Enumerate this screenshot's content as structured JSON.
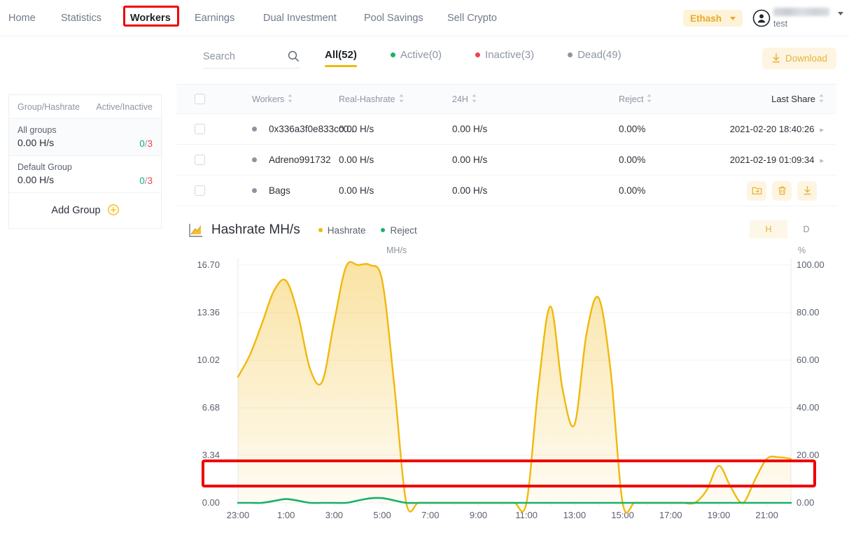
{
  "nav": {
    "items": [
      {
        "label": "Home",
        "active": false
      },
      {
        "label": "Statistics",
        "active": false
      },
      {
        "label": "Workers",
        "active": true
      },
      {
        "label": "Earnings",
        "active": false
      },
      {
        "label": "Dual Investment",
        "active": false
      },
      {
        "label": "Pool Savings",
        "active": false
      },
      {
        "label": "Sell Crypto",
        "active": false
      }
    ],
    "coin": "Ethash",
    "user_sub": "test",
    "highlight_color": "#ee0000"
  },
  "sidebar": {
    "header": {
      "left": "Group/Hashrate",
      "right": "Active/Inactive"
    },
    "groups": [
      {
        "name": "All groups",
        "hashrate": "0.00 H/s",
        "active": "0",
        "sep": "/",
        "inactive": "3",
        "selected": true
      },
      {
        "name": "Default Group",
        "hashrate": "0.00 H/s",
        "active": "0",
        "sep": "/",
        "inactive": "3",
        "selected": false
      }
    ],
    "add_group": "Add Group"
  },
  "search": {
    "placeholder": "Search",
    "value": ""
  },
  "tabs": [
    {
      "label": "All(52)",
      "dot": "none",
      "active": true
    },
    {
      "label": "Active(0)",
      "dot": "active",
      "active": false
    },
    {
      "label": "Inactive(3)",
      "dot": "inactive",
      "active": false
    },
    {
      "label": "Dead(49)",
      "dot": "dead",
      "active": false
    }
  ],
  "download_label": "Download",
  "table": {
    "columns": [
      "Workers",
      "Real-Hashrate",
      "24H",
      "Reject",
      "Last Share"
    ],
    "rows": [
      {
        "status": "dead",
        "worker": "0x336a3f0e833cc0...",
        "real_hashrate": "0.00 H/s",
        "h24": "0.00 H/s",
        "reject": "0.00%",
        "last_share": "2021-02-20 18:40:26",
        "show_actions": false
      },
      {
        "status": "dead",
        "worker": "Adreno991732",
        "real_hashrate": "0.00 H/s",
        "h24": "0.00 H/s",
        "reject": "0.00%",
        "last_share": "2021-02-19 01:09:34",
        "show_actions": false
      },
      {
        "status": "dead",
        "worker": "Bags",
        "real_hashrate": "0.00 H/s",
        "h24": "0.00 H/s",
        "reject": "0.00%",
        "last_share": "",
        "show_actions": true
      }
    ],
    "row_actions": [
      "move-to-group",
      "delete",
      "download"
    ]
  },
  "chart": {
    "title": "Hashrate MH/s",
    "legend": [
      {
        "label": "Hashrate",
        "color": "#f0b90b"
      },
      {
        "label": "Reject",
        "color": "#17b26a"
      }
    ],
    "range_buttons": [
      {
        "label": "H",
        "active": true
      },
      {
        "label": "D",
        "active": false
      }
    ]
  },
  "chart_data": {
    "type": "area",
    "title": "Hashrate MH/s",
    "xlabel": "",
    "ylabel": "MH/s",
    "y2label": "%",
    "ylim": [
      0,
      16.7
    ],
    "y2lim": [
      0,
      100
    ],
    "grid": true,
    "legend_position": "top-left",
    "yticks": [
      "0.00",
      "3.34",
      "6.68",
      "10.02",
      "13.36",
      "16.70"
    ],
    "y2ticks": [
      "0.00",
      "20.00",
      "40.00",
      "60.00",
      "80.00",
      "100.00"
    ],
    "xticks": [
      "23:00",
      "1:00",
      "3:00",
      "5:00",
      "7:00",
      "9:00",
      "11:00",
      "13:00",
      "15:00",
      "17:00",
      "19:00",
      "21:00"
    ],
    "x": [
      "23:00",
      "23:30",
      "0:00",
      "0:30",
      "1:00",
      "1:30",
      "2:00",
      "2:30",
      "3:00",
      "3:30",
      "4:00",
      "4:30",
      "5:00",
      "5:30",
      "6:00",
      "6:30",
      "7:00",
      "7:30",
      "8:00",
      "8:30",
      "9:00",
      "9:30",
      "10:00",
      "10:30",
      "11:00",
      "11:30",
      "12:00",
      "12:30",
      "13:00",
      "13:30",
      "14:00",
      "14:30",
      "15:00",
      "15:30",
      "16:00",
      "16:30",
      "17:00",
      "17:30",
      "18:00",
      "18:30",
      "19:00",
      "19:30",
      "20:00",
      "20:30",
      "21:00",
      "21:30",
      "22:00"
    ],
    "series": [
      {
        "name": "Hashrate",
        "color": "#f0b90b",
        "axis": "left",
        "unit": "MH/s",
        "values": [
          8.85,
          10.4,
          12.6,
          14.9,
          15.6,
          13.2,
          9.4,
          8.5,
          12.7,
          16.6,
          16.7,
          16.7,
          15.6,
          8.3,
          0.0,
          0.0,
          0.0,
          0.0,
          0.0,
          0.0,
          0.0,
          0.0,
          0.0,
          0.0,
          0.0,
          8.2,
          13.8,
          8.0,
          5.5,
          11.9,
          14.4,
          9.3,
          0.0,
          0.0,
          0.0,
          0.0,
          0.0,
          0.0,
          0.0,
          0.9,
          2.6,
          1.1,
          0.0,
          1.6,
          3.1,
          3.2,
          3.1
        ]
      },
      {
        "name": "Reject",
        "color": "#17b26a",
        "axis": "right",
        "unit": "%",
        "values": [
          0.0,
          0.0,
          0.0,
          0.8,
          1.6,
          0.9,
          0.0,
          0.0,
          0.0,
          0.0,
          1.0,
          1.9,
          2.0,
          1.0,
          0.0,
          0.0,
          0.0,
          0.0,
          0.0,
          0.0,
          0.0,
          0.0,
          0.0,
          0.0,
          0.0,
          0.0,
          0.0,
          0.0,
          0.0,
          0.0,
          0.0,
          0.0,
          0.0,
          0.0,
          0.0,
          0.0,
          0.0,
          0.0,
          0.0,
          0.0,
          0.0,
          0.0,
          0.0,
          0.0,
          0.0,
          0.0,
          0.0
        ]
      }
    ]
  }
}
